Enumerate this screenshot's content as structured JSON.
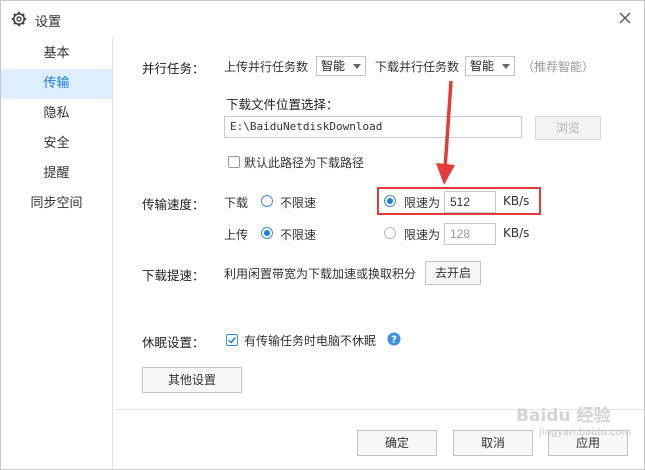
{
  "window": {
    "title": "设置"
  },
  "sidebar": {
    "items": [
      {
        "label": "基本",
        "active": false
      },
      {
        "label": "传输",
        "active": true
      },
      {
        "label": "隐私",
        "active": false
      },
      {
        "label": "安全",
        "active": false
      },
      {
        "label": "提醒",
        "active": false
      },
      {
        "label": "同步空间",
        "active": false
      }
    ]
  },
  "parallel": {
    "title": "并行任务：",
    "upload_label": "上传并行任务数",
    "upload_value": "智能",
    "download_label": "下载并行任务数",
    "download_value": "智能",
    "hint": "（推荐智能）"
  },
  "location": {
    "title": "下载文件位置选择：",
    "path": "E:\\BaiduNetdiskDownload",
    "browse_label": "浏览",
    "default_checkbox_label": "默认此路径为下载路径",
    "default_checked": false
  },
  "speed": {
    "title": "传输速度：",
    "download_label": "下载",
    "upload_label": "上传",
    "unlimited_label": "不限速",
    "limit_label": "限速为",
    "unit": "KB/s",
    "download_mode": "limit",
    "download_limit": "512",
    "upload_mode": "unlimited",
    "upload_limit": "128"
  },
  "boost": {
    "title": "下载提速：",
    "description": "利用闲置带宽为下载加速或换取积分",
    "button_label": "去开启"
  },
  "sleep": {
    "title": "休眠设置：",
    "checkbox_label": "有传输任务时电脑不休眠",
    "checked": true
  },
  "other_settings_label": "其他设置",
  "footer": {
    "ok_label": "确定",
    "cancel_label": "取消",
    "apply_label": "应用"
  },
  "watermark": {
    "text": "Baidu 经验",
    "sub": "jingyan.baidu.com"
  },
  "colors": {
    "accent": "#1a7fe0",
    "sidebar_active_bg": "#dceeff",
    "annotation_red": "#e53a3a"
  }
}
